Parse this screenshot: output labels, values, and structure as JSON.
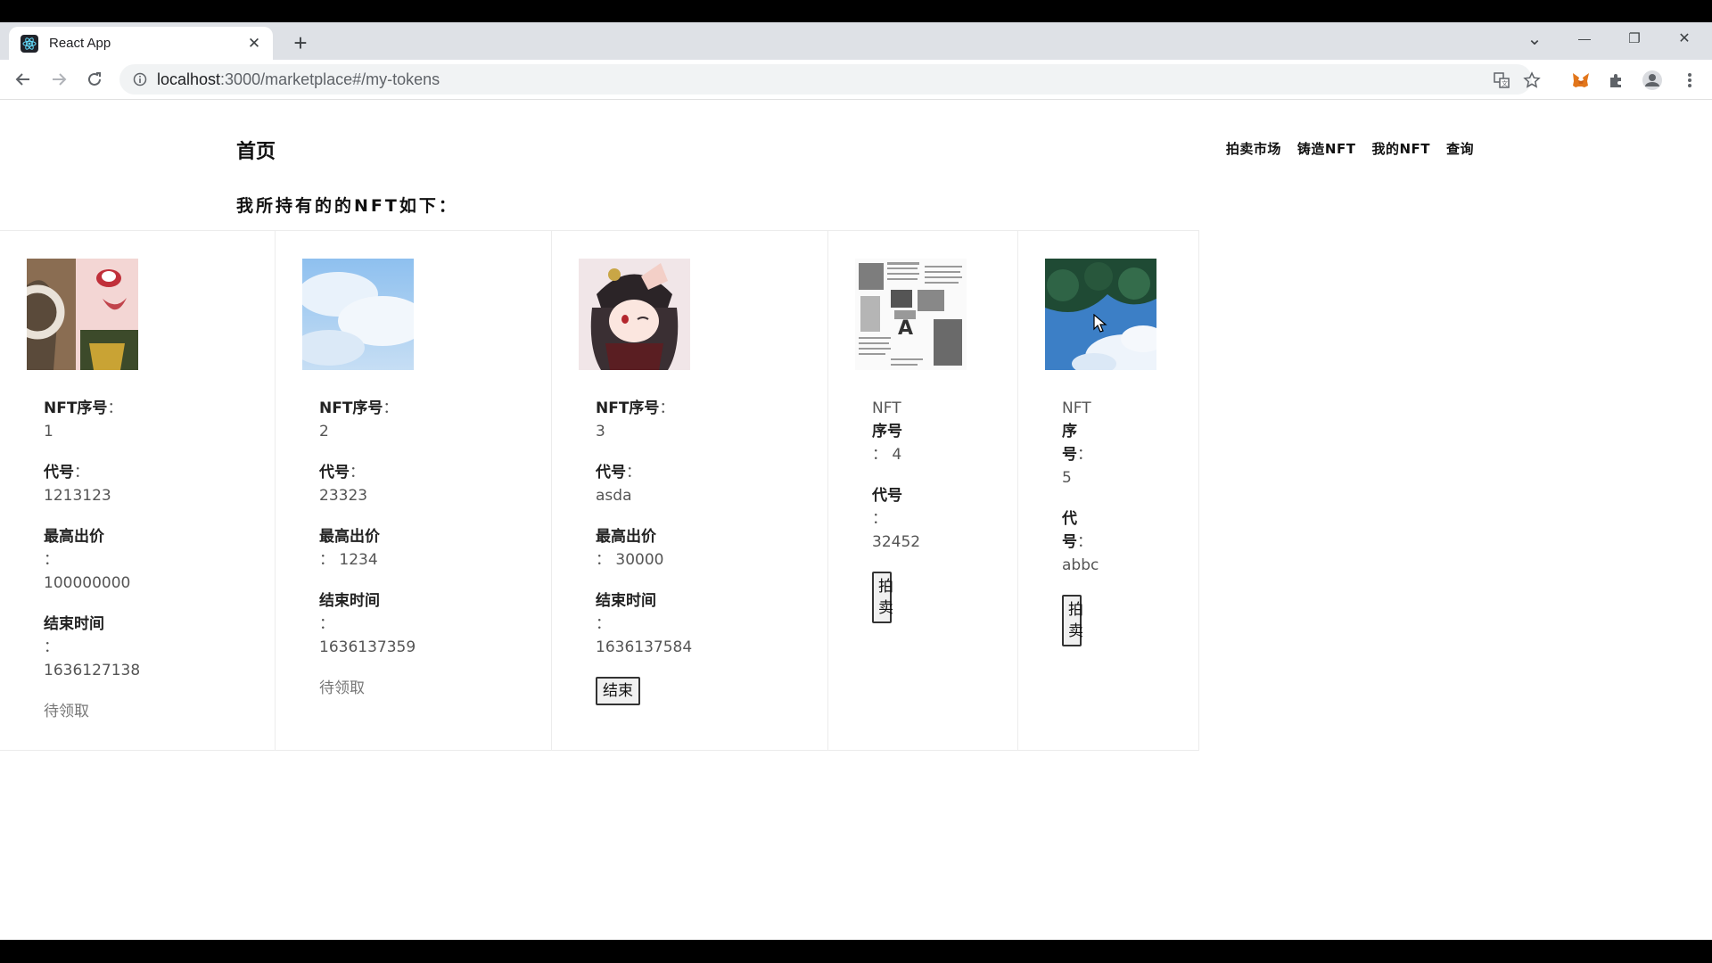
{
  "browser": {
    "tab_title": "React App",
    "tab_close": "✕",
    "new_tab": "+",
    "url_host": "localhost",
    "url_path": ":3000/marketplace#/my-tokens",
    "window_controls": [
      "⌄",
      "—",
      "❐",
      "✕"
    ]
  },
  "site": {
    "brand": "首页",
    "nav": [
      {
        "label": "拍卖市场"
      },
      {
        "label": "铸造NFT"
      },
      {
        "label": "我的NFT"
      },
      {
        "label": "查询"
      }
    ],
    "heading": "我所持有的的NFT如下："
  },
  "cards": [
    {
      "image": "anime-girl-avatar",
      "id_label": "NFT序号",
      "id_value": "1",
      "code_label": "代号",
      "code_value": "1213123",
      "bid_label": "最高出价",
      "bid_value": "100000000",
      "end_label": "结束时间",
      "end_value": "1636127138",
      "status": "待领取"
    },
    {
      "image": "sky-clouds",
      "id_label": "NFT序号",
      "id_value": "2",
      "code_label": "代号",
      "code_value": "23323",
      "bid_label": "最高出价",
      "bid_value": "1234",
      "end_label": "结束时间",
      "end_value": "1636137359",
      "status": "待领取"
    },
    {
      "image": "anime-character-hat",
      "id_label": "NFT序号",
      "id_value": "3",
      "code_label": "代号",
      "code_value": "asda",
      "bid_label": "最高出价",
      "bid_value": "30000",
      "end_label": "结束时间",
      "end_value": "1636137584",
      "button": "结束"
    },
    {
      "image": "newspaper-collage",
      "id_label_a": "NFT",
      "id_label_b": "序号",
      "id_value": "4",
      "code_label": "代号",
      "code_value": "32452",
      "button_line1": "拍",
      "button_line2": "卖"
    },
    {
      "image": "leaves-sky",
      "id_label_a": "NFT",
      "id_label_b": "序",
      "id_label_c": "号",
      "id_value": "5",
      "code_label_a": "代",
      "code_label_b": "号",
      "code_value": "abbc",
      "button_line1": "拍",
      "button_line2": "卖"
    }
  ],
  "colon": "："
}
